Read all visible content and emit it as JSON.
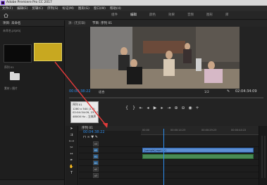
{
  "window": {
    "title": "Adobe Premiere Pro CC 2017"
  },
  "menu": [
    "文件(F)",
    "编辑(E)",
    "剪辑(C)",
    "序列(S)",
    "标记(M)",
    "图形(G)",
    "窗口(W)",
    "帮助(H)"
  ],
  "workspaces": [
    "组件",
    "编辑",
    "颜色",
    "效果",
    "音频",
    "图形",
    "库"
  ],
  "project": {
    "tab": "项目: 未命名",
    "path": "未命名.prproj",
    "items": [
      {
        "caption": "序列 01"
      },
      {
        "caption": ""
      }
    ],
    "folder_caption": "素材 / 图片"
  },
  "monitor": {
    "tabs": [
      "源: (无剪辑)",
      "节目: 序列 01"
    ],
    "timecode_left": "00:00:38:22",
    "timecode_right": "02:04:34:09",
    "fit_label": "适合",
    "scale_label": "1/2"
  },
  "tooltip": {
    "lines": [
      "序列 01",
      "1280 x 544 (1.0)",
      "02:04:34:09, 23.976p",
      "48000 Hz - 立体声"
    ]
  },
  "timeline": {
    "tab": "序列 01",
    "timecode": "00:04:38:22",
    "ruler": [
      "00:00",
      "00:00:14:23",
      "00:00:29:23",
      "00:00:44:22"
    ],
    "tracks": [
      "V3",
      "V2",
      "V1",
      "A1",
      "A2",
      "A3"
    ],
    "video_clip": "[sample].mp4 [V]"
  },
  "colors": {
    "accent": "#2d8ceb",
    "selection": "#c8a820",
    "arrow": "#e33a3a"
  }
}
